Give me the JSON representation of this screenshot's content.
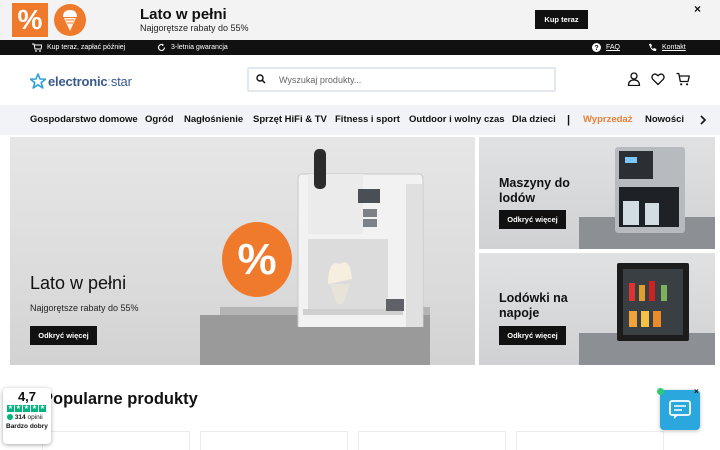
{
  "promo": {
    "badge_text": "%",
    "title": "Lato w pełni",
    "subtitle": "Najgorętsze rabaty do 55%",
    "cta": "Kup teraz",
    "close": "×",
    "accent": "#f07a2b"
  },
  "infobar": {
    "buy_now_pay_later": "Kup teraz, zapłać później",
    "warranty": "3-letnia gwarancja",
    "faq": "FAQ",
    "contact": "Kontakt"
  },
  "header": {
    "logo_left": "electronic",
    "logo_right": "star",
    "search_placeholder": "Wyszukaj produkty...",
    "icons": [
      "user-icon",
      "heart-icon",
      "cart-icon"
    ]
  },
  "nav": {
    "items": [
      "Gospodarstwo domowe",
      "Ogród",
      "Nagłośnienie",
      "Sprzęt HiFi & TV",
      "Fitness i sport",
      "Outdoor i wolny czas",
      "Dla dzieci"
    ],
    "separator": "|",
    "sale": "Wyprzedaż",
    "news": "Nowości",
    "sale_color": "#e8803a"
  },
  "hero": {
    "badge": "%",
    "title": "Lato w pełni",
    "subtitle": "Najgorętsze rabaty do 55%",
    "cta": "Odkryć więcej"
  },
  "tiles": [
    {
      "title_line1": "Maszyny do",
      "title_line2": "lodów",
      "cta": "Odkryć więcej"
    },
    {
      "title_line1": "Lodówki na",
      "title_line2": "napoje",
      "cta": "Odkryć więcej"
    }
  ],
  "popular": {
    "heading": "Popularne produkty"
  },
  "rating": {
    "score": "4,7",
    "count": "314",
    "count_label": "opinii",
    "verdict": "Bardzo dobry",
    "color": "#00b67a"
  },
  "chat": {
    "close": "×",
    "color": "#2aa8dd"
  }
}
